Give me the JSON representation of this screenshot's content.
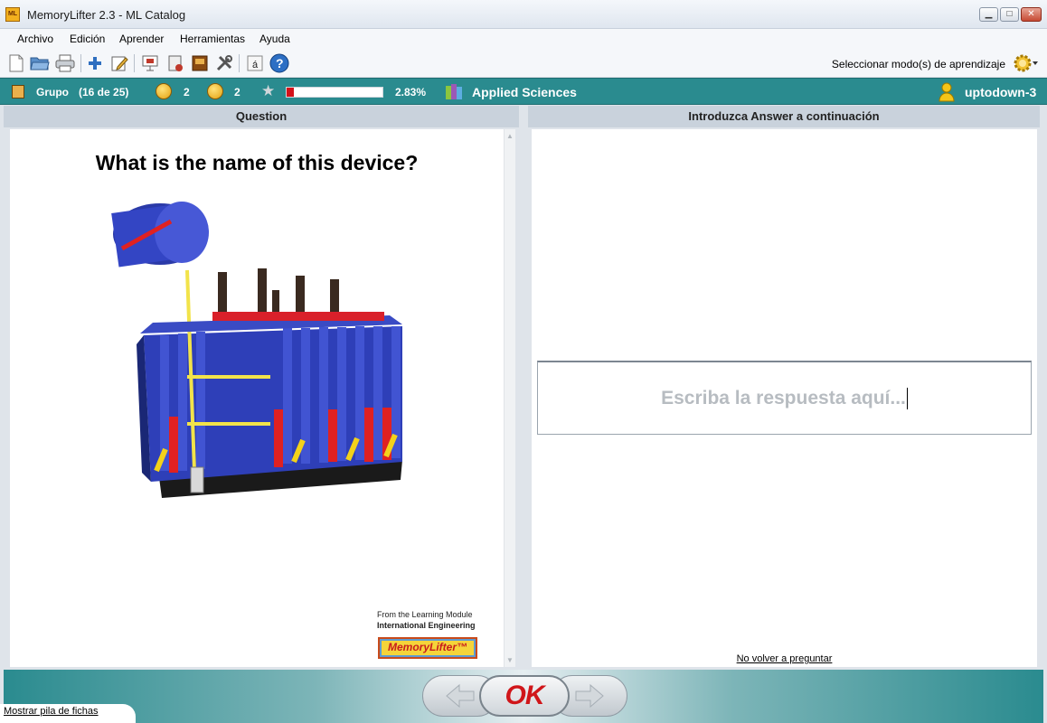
{
  "window": {
    "title": "MemoryLifter 2.3 - ML Catalog",
    "icon_text": "ML"
  },
  "menu": [
    "Archivo",
    "Edición",
    "Aprender",
    "Herramientas",
    "Ayuda"
  ],
  "toolbar": {
    "icons": [
      "new-file-icon",
      "open-folder-icon",
      "print-icon",
      "add-icon",
      "edit-icon",
      "presentation-icon",
      "cards-icon",
      "book-icon",
      "tools-icon",
      "accent-icon",
      "help-icon"
    ],
    "mode_label": "Seleccionar modo(s) de aprendizaje"
  },
  "status": {
    "group_label": "Grupo",
    "group_count": "(16 de 25)",
    "correct_count": "2",
    "wrong_count": "2",
    "progress_percent": "2.83%",
    "progress_value": 0.0283,
    "category": "Applied Sciences",
    "user": "uptodown-3"
  },
  "panels": {
    "question_header": "Question",
    "answer_header": "Introduzca Answer a continuación"
  },
  "question": {
    "text": "What is the name of this device?",
    "credit_line1": "From the Learning Module",
    "credit_line2": "International Engineering",
    "logo_text": "MemoryLifter™"
  },
  "answer": {
    "placeholder": "Escriba la respuesta aquí...",
    "no_repeat_link": "No volver a preguntar"
  },
  "bottom": {
    "ok_label": "OK",
    "show_stack_link": "Mostrar pila de fichas"
  },
  "colors": {
    "teal": "#2a8b8f",
    "progress_red": "#d4121a",
    "ok_red": "#d0161a"
  }
}
